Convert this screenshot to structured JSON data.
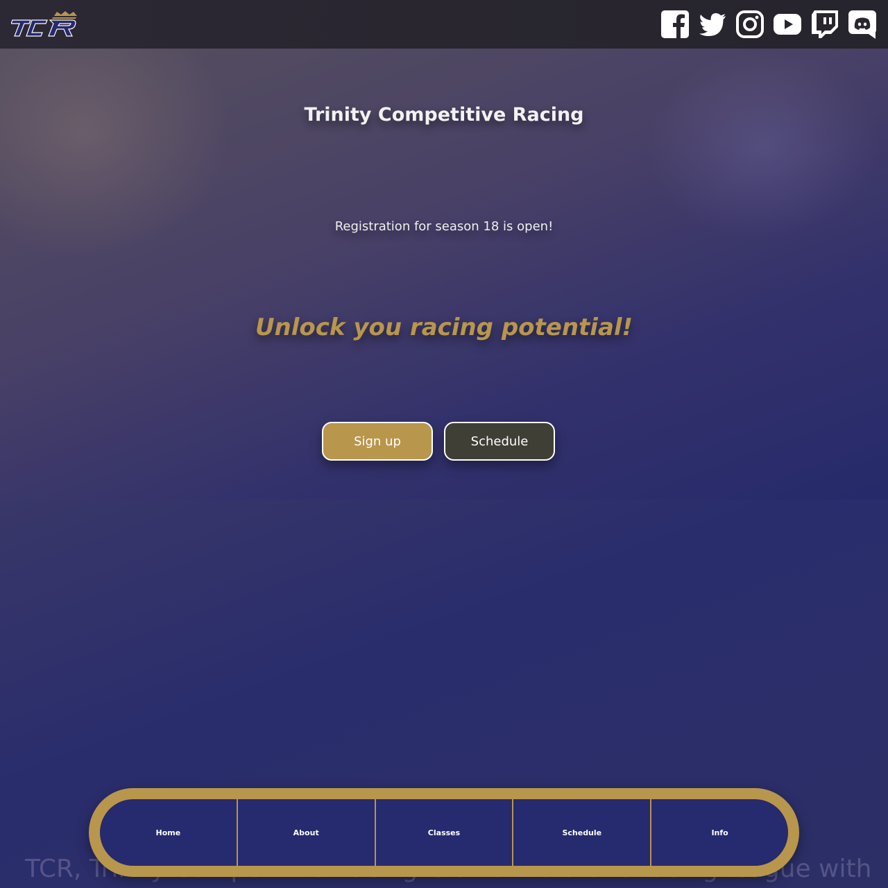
{
  "header": {
    "logo_text": "TCR",
    "socials": [
      {
        "name": "facebook-icon"
      },
      {
        "name": "twitter-icon"
      },
      {
        "name": "instagram-icon"
      },
      {
        "name": "youtube-icon"
      },
      {
        "name": "twitch-icon"
      },
      {
        "name": "discord-icon"
      }
    ]
  },
  "hero": {
    "title": "Trinity Competitive Racing",
    "subtitle": "Registration for season 18 is open!",
    "tagline": "Unlock you racing potential!",
    "buttons": {
      "signup": "Sign up",
      "schedule": "Schedule"
    }
  },
  "footer_text": "TCR, Trinity Competitive Racing is a Formula one racing league with c",
  "nav": {
    "items": [
      "Home",
      "About",
      "Classes",
      "Schedule",
      "Info"
    ]
  },
  "colors": {
    "gold": "#b8964c",
    "navy": "#262a6e",
    "dark_button": "#403f36",
    "topbar": "#2a2630"
  }
}
